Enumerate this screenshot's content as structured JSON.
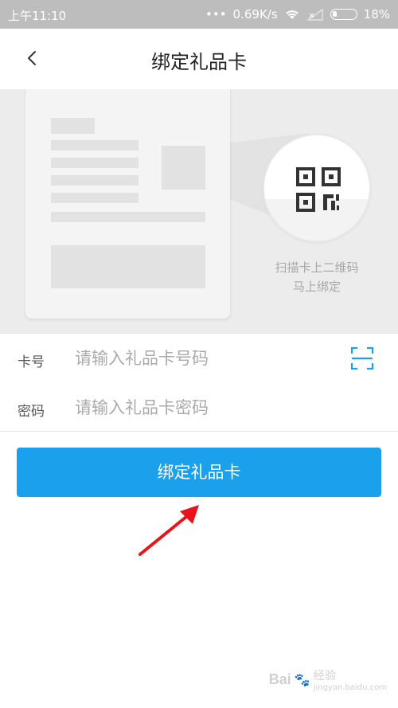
{
  "status_bar": {
    "time": "上午11:10",
    "network_speed": "0.69K/s",
    "battery_percent": "18%"
  },
  "nav": {
    "title": "绑定礼品卡"
  },
  "hero": {
    "scan_hint_line1": "扫描卡上二维码",
    "scan_hint_line2": "马上绑定"
  },
  "form": {
    "card_number": {
      "label": "卡号",
      "placeholder": "请输入礼品卡号码",
      "value": ""
    },
    "password": {
      "label": "密码",
      "placeholder": "请输入礼品卡密码",
      "value": ""
    }
  },
  "actions": {
    "bind_label": "绑定礼品卡"
  },
  "colors": {
    "accent": "#1ba1ec",
    "arrow": "#e8141a"
  },
  "watermark": {
    "brand": "Bai",
    "brand_suffix": "经验",
    "url": "jingyan.baidu.com"
  }
}
